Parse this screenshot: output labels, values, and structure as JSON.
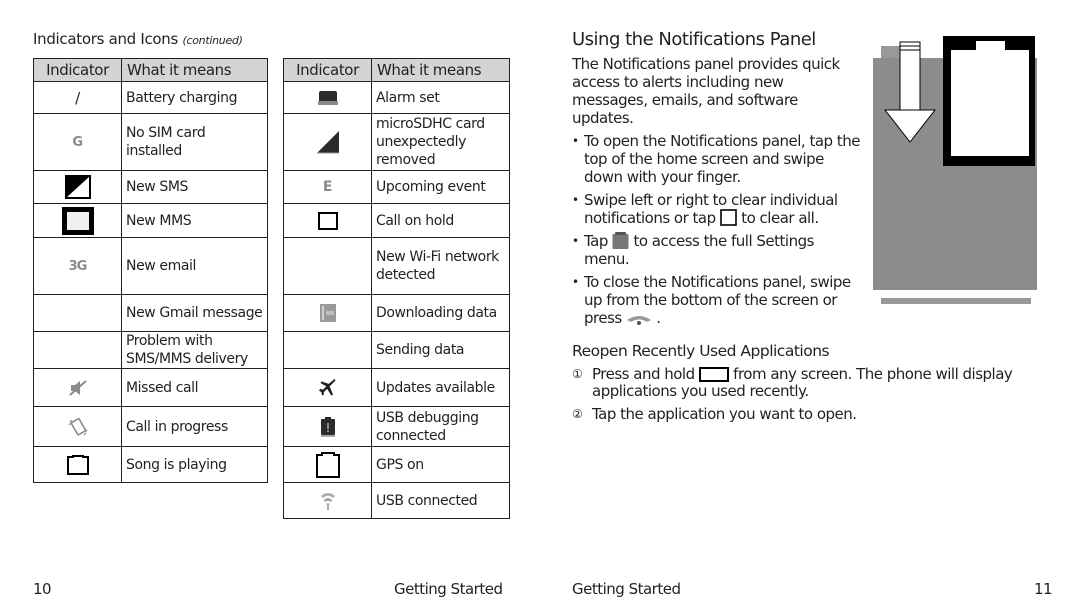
{
  "left_page": {
    "section_title": "Indicators and Icons",
    "section_title_suffix": "(continued)",
    "table_headers": {
      "indicator": "Indicator",
      "meaning": "What it means"
    },
    "table_left": [
      {
        "icon": "slash-glyph",
        "icon_text": "/",
        "meaning": "Battery charging"
      },
      {
        "icon": "letter-g-icon",
        "icon_text": "G",
        "meaning": "No SIM card installed"
      },
      {
        "icon": "half-filled-square-icon",
        "icon_text": "",
        "meaning": "New SMS"
      },
      {
        "icon": "thick-square-icon",
        "icon_text": "",
        "meaning": "New MMS"
      },
      {
        "icon": "3g-icon",
        "icon_text": "3G",
        "meaning": "New email"
      },
      {
        "icon": "none",
        "icon_text": "",
        "meaning": "New Gmail message"
      },
      {
        "icon": "none",
        "icon_text": "",
        "meaning": "Problem with SMS/MMS delivery"
      },
      {
        "icon": "muted-speaker-icon",
        "icon_text": "",
        "meaning": "Missed call"
      },
      {
        "icon": "vibrate-icon",
        "icon_text": "",
        "meaning": "Call in progress"
      },
      {
        "icon": "battery-outline-icon",
        "icon_text": "",
        "meaning": "Song is playing"
      }
    ],
    "table_right": [
      {
        "icon": "alarm-block-icon",
        "icon_text": "",
        "meaning": "Alarm set"
      },
      {
        "icon": "signal-triangle-icon",
        "icon_text": "",
        "meaning": "microSDHC card unexpectedly removed"
      },
      {
        "icon": "letter-e-icon",
        "icon_text": "E",
        "meaning": "Upcoming event"
      },
      {
        "icon": "square-outline-icon",
        "icon_text": "",
        "meaning": "Call on hold"
      },
      {
        "icon": "none",
        "icon_text": "",
        "meaning": "New Wi-Fi network detected"
      },
      {
        "icon": "data-icon",
        "icon_text": "",
        "meaning": "Downloading data"
      },
      {
        "icon": "none",
        "icon_text": "",
        "meaning": "Sending data"
      },
      {
        "icon": "airplane-icon",
        "icon_text": "",
        "meaning": "Updates available"
      },
      {
        "icon": "alert-battery-icon",
        "icon_text": "",
        "meaning": "USB debugging connected"
      },
      {
        "icon": "battery-outline-icon",
        "icon_text": "",
        "meaning": "GPS on"
      },
      {
        "icon": "wifi-icon",
        "icon_text": "",
        "meaning": "USB connected"
      }
    ],
    "page_number": "10",
    "footer_label": "Getting Started"
  },
  "right_page": {
    "title": "Using the Notifications Panel",
    "intro": "The Notifications panel provides quick access to alerts including new messages, emails, and software updates.",
    "bullets": [
      {
        "before": "To open the Notifications panel, tap the top of the home screen and swipe down with your finger.",
        "after": ""
      },
      {
        "before": "Swipe left or right to clear individual notifications or tap",
        "after": "to clear all."
      },
      {
        "before": "Tap",
        "after": "to access the full Settings menu."
      },
      {
        "before": "To close the Notifications panel, swipe up from the bottom of the screen or press",
        "after": "."
      }
    ],
    "subheading": "Reopen Recently Used Applications",
    "steps": [
      {
        "num": "①",
        "before": "Press and hold",
        "after": "from any screen. The phone will display applications you used recently."
      },
      {
        "num": "②",
        "before": "Tap the application you want to open.",
        "after": ""
      }
    ],
    "footer_label": "Getting Started",
    "page_number": "11"
  }
}
